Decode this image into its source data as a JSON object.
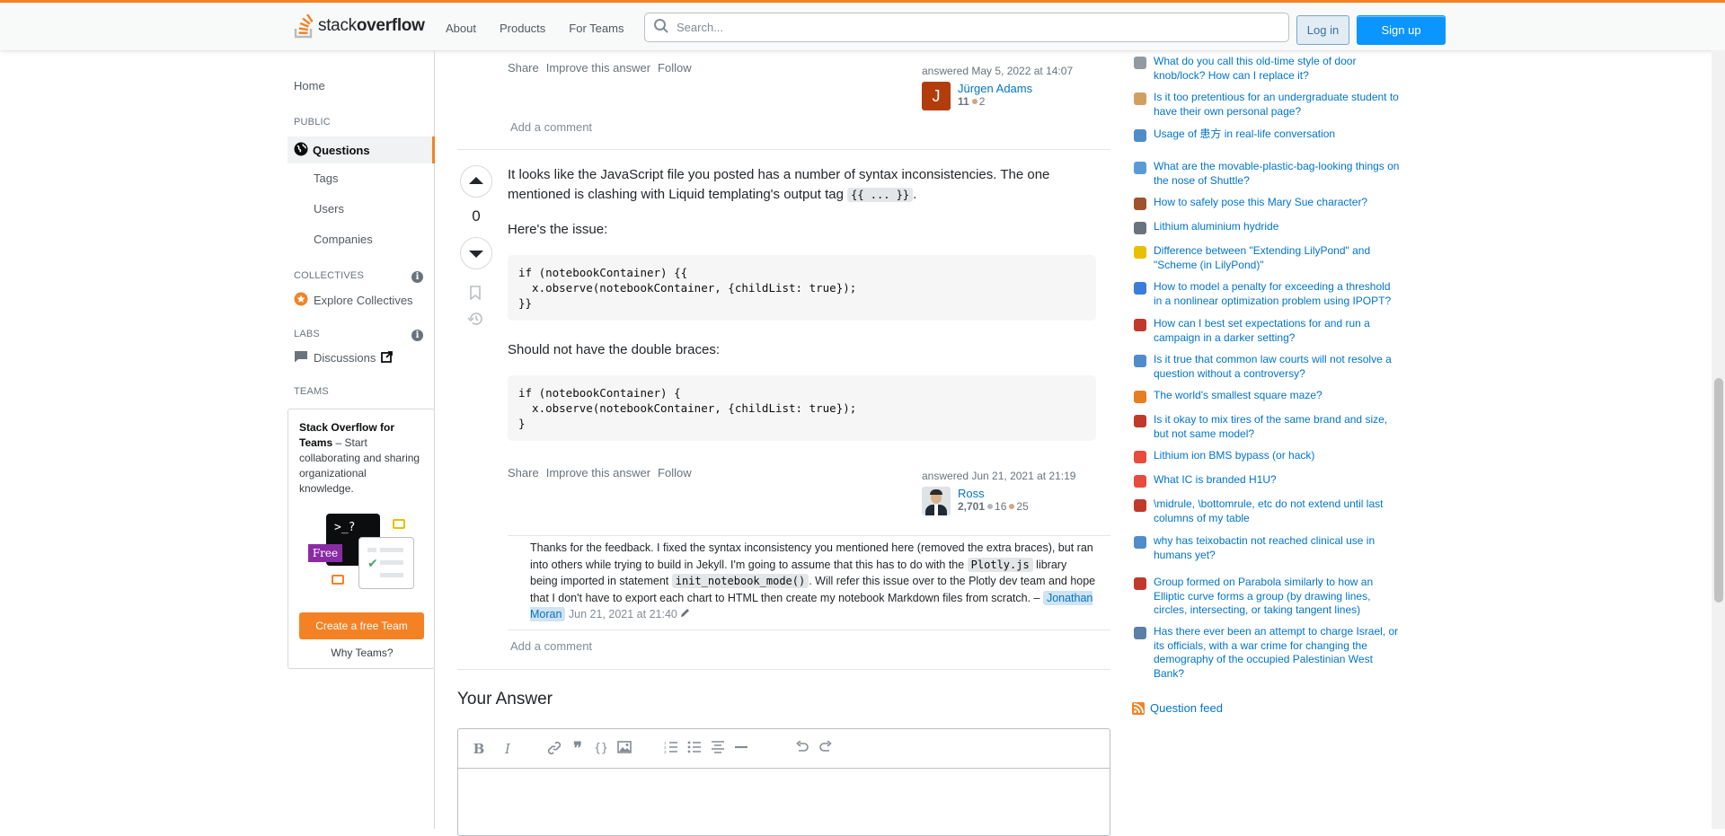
{
  "header": {
    "logo_light": "stack",
    "logo_bold": "overflow",
    "nav": [
      "About",
      "Products",
      "For Teams"
    ],
    "search_placeholder": "Search...",
    "login": "Log in",
    "signup": "Sign up"
  },
  "sidebar": {
    "home": "Home",
    "public": "PUBLIC",
    "questions": "Questions",
    "tags": "Tags",
    "users": "Users",
    "companies": "Companies",
    "collectives": "COLLECTIVES",
    "explore_collectives": "Explore Collectives",
    "labs": "LABS",
    "discussions": "Discussions",
    "teams": "TEAMS",
    "teams_card": {
      "title": "Stack Overflow for Teams",
      "body": " – Start collaborating and sharing organizational knowledge.",
      "free_badge": "Free",
      "terminal_text": ">_?",
      "create_button": "Create a free Team",
      "why_link": "Why Teams?"
    }
  },
  "answer_prev": {
    "actions": [
      "Share",
      "Improve this answer",
      "Follow"
    ],
    "answered": "answered May 5, 2022 at 14:07",
    "user": {
      "name": "Jürgen Adams",
      "initial": "J",
      "rep": "11",
      "bronze": "2",
      "avatar_color": "#b33c0c"
    },
    "add_comment": "Add a comment"
  },
  "answer": {
    "vote_count": "0",
    "intro_1": "It looks like the JavaScript file you posted has a number of syntax inconsistencies. The one mentioned is clashing with Liquid templating's output tag ",
    "intro_code": "{{ ... }}",
    "intro_2": ".",
    "issue_label": "Here's the issue:",
    "code_bad": "if (notebookContainer) {{\n  x.observe(notebookContainer, {childList: true});\n}}",
    "fix_label": "Should not have the double braces:",
    "code_good": "if (notebookContainer) {\n  x.observe(notebookContainer, {childList: true});\n}",
    "actions": [
      "Share",
      "Improve this answer",
      "Follow"
    ],
    "answered": "answered Jun 21, 2021 at 21:19",
    "user": {
      "name": "Ross",
      "rep": "2,701",
      "silver": "16",
      "bronze": "25"
    },
    "add_comment": "Add a comment"
  },
  "comment": {
    "text_1": "Thanks for the feedback. I fixed the syntax inconsistency you mentioned here (removed the extra braces), but ran into others while trying to build in Jekyll. I'm going to assume that this has to do with the ",
    "code_1": "Plotly.js",
    "text_2": " library being imported in statement ",
    "code_2": "init_notebook_mode()",
    "text_3": ". Will refer this issue over to the Plotly dev team and hope that I don't have to export each chart to HTML then create my notebook Markdown files from scratch. – ",
    "user": "Jonathan Moran",
    "time": "Jun 21, 2021 at 21:40"
  },
  "your_answer": "Your Answer",
  "hot_questions": [
    {
      "title": "What do you call this old-time style of door knob/lock? How can I replace it?",
      "color": "#9199a1"
    },
    {
      "title": "Is it too pretentious for an undergraduate student to have their own personal page?",
      "color": "#d0a060"
    },
    {
      "title": "Usage of 患方 in real-life conversation",
      "color": "#4f8cc9"
    },
    {
      "title": "What are the movable-plastic-bag-looking things on the nose of Shuttle?",
      "color": "#5b9bd5"
    },
    {
      "title": "How to safely pose this Mary Sue character?",
      "color": "#a0522d"
    },
    {
      "title": "Lithium aluminium hydride",
      "color": "#6a737c"
    },
    {
      "title": "Difference between \"Extending LilyPond\" and \"Scheme (in LilyPond)\"",
      "color": "#e8c000"
    },
    {
      "title": "How to model a penalty for exceeding a threshold in a nonlinear optimization problem using IPOPT?",
      "color": "#3b7dd8"
    },
    {
      "title": "How can I best set expectations for and run a campaign in a darker setting?",
      "color": "#c0392b"
    },
    {
      "title": "Is it true that common law courts will not resolve a question without a controversy?",
      "color": "#4f8cc9"
    },
    {
      "title": "The world's smallest square maze?",
      "color": "#e67e22"
    },
    {
      "title": "Is it okay to mix tires of the same brand and size, but not same model?",
      "color": "#c0392b"
    },
    {
      "title": "Lithium ion BMS bypass (or hack)",
      "color": "#e74c3c"
    },
    {
      "title": "What IC is branded H1U?",
      "color": "#e74c3c"
    },
    {
      "title": "\\midrule, \\bottomrule, etc do not extend until last columns of my table",
      "color": "#c0392b"
    },
    {
      "title": "why has teixobactin not reached clinical use in humans yet?",
      "color": "#4f8cc9"
    },
    {
      "title": "Group formed on Parabola similarly to how an Elliptic curve forms a group (by drawing lines, circles, intersecting, or taking tangent lines)",
      "color": "#c0392b"
    },
    {
      "title": "Has there ever been an attempt to charge Israel, or its officials, with a war crime for changing the demography of the occupied Palestinian West Bank?",
      "color": "#5b7fa6"
    }
  ],
  "question_feed": "Question feed",
  "editor_tools": [
    "B",
    "I"
  ]
}
